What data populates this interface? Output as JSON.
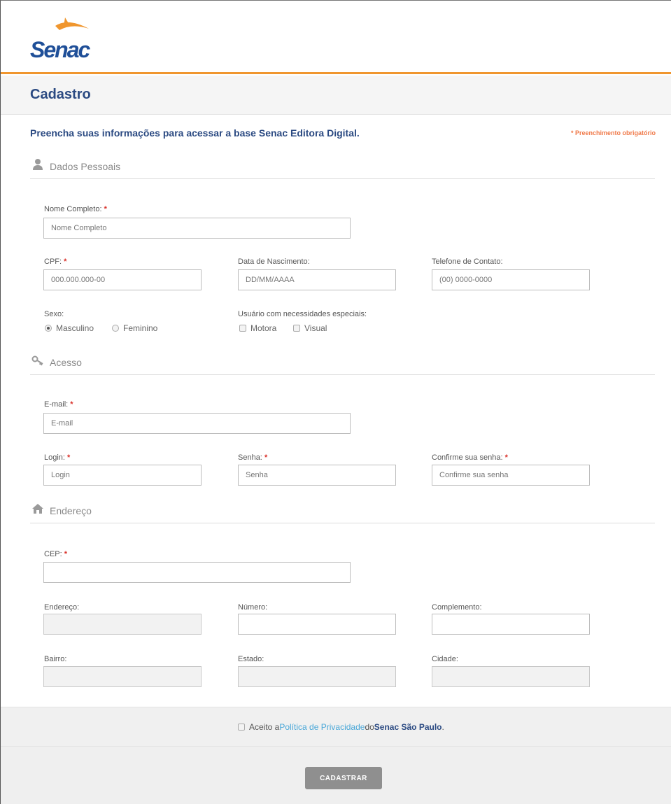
{
  "brand": {
    "logo_text": "Senac",
    "logo_blue": "#1f4f98",
    "logo_orange": "#f0962e"
  },
  "page": {
    "title": "Cadastro"
  },
  "intro": {
    "text": "Preencha suas informações para acessar a base Senac Editora Digital.",
    "required_note": "* Preenchimento obrigatório"
  },
  "sections": {
    "personal": {
      "title": "Dados Pessoais",
      "icon": "user-icon"
    },
    "access": {
      "title": "Acesso",
      "icon": "key-icon"
    },
    "address": {
      "title": "Endereço",
      "icon": "home-icon"
    }
  },
  "fields": {
    "full_name": {
      "label": "Nome Completo:",
      "placeholder": "Nome Completo",
      "required": "*"
    },
    "cpf": {
      "label": "CPF:",
      "placeholder": "000.000.000-00",
      "required": "*"
    },
    "birth_date": {
      "label": "Data de Nascimento:",
      "placeholder": "DD/MM/AAAA"
    },
    "phone": {
      "label": "Telefone de Contato:",
      "placeholder": "(00) 0000-0000"
    },
    "sex": {
      "label": "Sexo:",
      "options": [
        "Masculino",
        "Feminino"
      ],
      "selected": "Masculino"
    },
    "special_needs": {
      "label": "Usuário com necessidades especiais:",
      "options": [
        "Motora",
        "Visual"
      ]
    },
    "email": {
      "label": "E-mail:",
      "placeholder": "E-mail",
      "required": "*"
    },
    "login": {
      "label": "Login:",
      "placeholder": "Login",
      "required": "*"
    },
    "password": {
      "label": "Senha:",
      "placeholder": "Senha",
      "required": "*"
    },
    "confirm_password": {
      "label": "Confirme sua senha:",
      "placeholder": "Confirme sua senha",
      "required": "*"
    },
    "cep": {
      "label": "CEP:",
      "required": "*"
    },
    "street": {
      "label": "Endereço:"
    },
    "number": {
      "label": "Número:"
    },
    "complement": {
      "label": "Complemento:"
    },
    "neighborhood": {
      "label": "Bairro:"
    },
    "state": {
      "label": "Estado:"
    },
    "city": {
      "label": "Cidade:"
    }
  },
  "footer": {
    "accept_prefix": "Aceito a",
    "policy_link": "Política de Privacidade",
    "accept_mid": "do",
    "brand": "Senac São Paulo",
    "accept_suffix": ".",
    "submit": "CADASTRAR"
  }
}
